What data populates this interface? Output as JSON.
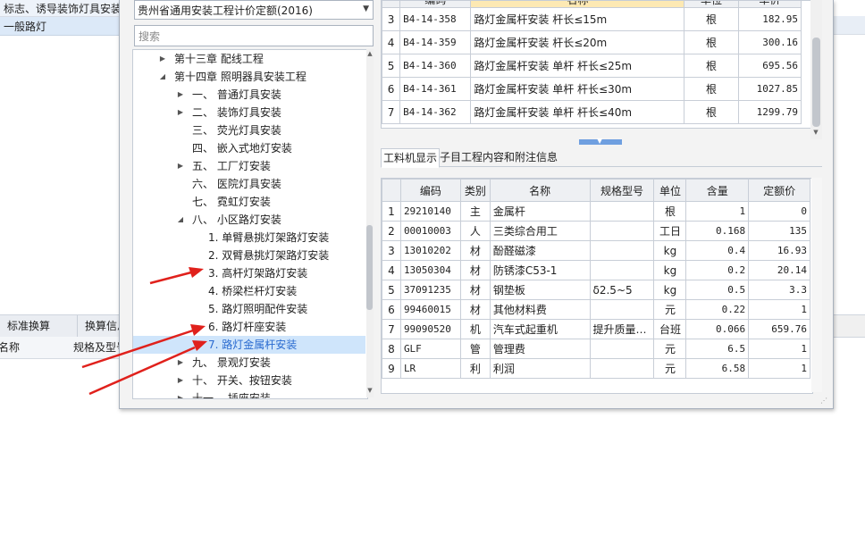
{
  "background": {
    "row1_text": "标志、诱导装饰灯具安装",
    "row2_text": "一般路灯",
    "tabs": [
      "标准换算",
      "换算信息"
    ],
    "columns": [
      "名称",
      "规格及型号"
    ]
  },
  "left_panel": {
    "quota_select": "贵州省通用安装工程计价定额(2016)",
    "search_placeholder": "搜索",
    "tree": [
      {
        "label": "第十三章  配线工程",
        "state": "collapsed"
      },
      {
        "label": "第十四章  照明器具安装工程",
        "state": "expanded"
      },
      {
        "label": "一、  普通灯具安装",
        "state": "collapsed"
      },
      {
        "label": "二、  装饰灯具安装",
        "state": "collapsed"
      },
      {
        "label": "三、  荧光灯具安装",
        "state": "leaf"
      },
      {
        "label": "四、  嵌入式地灯安装",
        "state": "leaf"
      },
      {
        "label": "五、  工厂灯安装",
        "state": "collapsed"
      },
      {
        "label": "六、  医院灯具安装",
        "state": "leaf"
      },
      {
        "label": "七、  霓虹灯安装",
        "state": "leaf"
      },
      {
        "label": "八、  小区路灯安装",
        "state": "expanded"
      },
      {
        "label": "1.  单臂悬挑灯架路灯安装",
        "state": "leaf"
      },
      {
        "label": "2.  双臂悬挑灯架路灯安装",
        "state": "leaf"
      },
      {
        "label": "3.  高杆灯架路灯安装",
        "state": "leaf"
      },
      {
        "label": "4.  桥梁栏杆灯安装",
        "state": "leaf"
      },
      {
        "label": "5.  路灯照明配件安装",
        "state": "leaf"
      },
      {
        "label": "6.  路灯杆座安装",
        "state": "leaf"
      },
      {
        "label": "7.  路灯金属杆安装",
        "state": "selected"
      },
      {
        "label": "九、  景观灯安装",
        "state": "collapsed"
      },
      {
        "label": "十、  开关、按钮安装",
        "state": "collapsed"
      },
      {
        "label": "十一、  插座安装",
        "state": "collapsed"
      }
    ]
  },
  "top_grid": {
    "headers": [
      "",
      "编码",
      "名称",
      "单位",
      "单价"
    ],
    "rows": [
      {
        "no": "3",
        "code": "B4-14-358",
        "name": "路灯金属杆安装  杆长≤15m",
        "unit": "根",
        "price": "182.95"
      },
      {
        "no": "4",
        "code": "B4-14-359",
        "name": "路灯金属杆安装  杆长≤20m",
        "unit": "根",
        "price": "300.16"
      },
      {
        "no": "5",
        "code": "B4-14-360",
        "name": "路灯金属杆安装  单杆  杆长≤25m",
        "unit": "根",
        "price": "695.56"
      },
      {
        "no": "6",
        "code": "B4-14-361",
        "name": "路灯金属杆安装  单杆  杆长≤30m",
        "unit": "根",
        "price": "1027.85"
      },
      {
        "no": "7",
        "code": "B4-14-362",
        "name": "路灯金属杆安装  单杆  杆长≤40m",
        "unit": "根",
        "price": "1299.79"
      }
    ]
  },
  "sub_tabs": [
    "工料机显示",
    "子目工程内容和附注信息"
  ],
  "sub_grid": {
    "headers": [
      "",
      "编码",
      "类别",
      "名称",
      "规格型号",
      "单位",
      "含量",
      "定额价"
    ],
    "rows": [
      {
        "no": "1",
        "code": "29210140",
        "type": "主",
        "name": "金属杆",
        "spec": "",
        "unit": "根",
        "qty": "1",
        "price": "0"
      },
      {
        "no": "2",
        "code": "00010003",
        "type": "人",
        "name": "三类综合用工",
        "spec": "",
        "unit": "工日",
        "qty": "0.168",
        "price": "135"
      },
      {
        "no": "3",
        "code": "13010202",
        "type": "材",
        "name": "酚醛磁漆",
        "spec": "",
        "unit": "kg",
        "qty": "0.4",
        "price": "16.93"
      },
      {
        "no": "4",
        "code": "13050304",
        "type": "材",
        "name": "防锈漆C53-1",
        "spec": "",
        "unit": "kg",
        "qty": "0.2",
        "price": "20.14"
      },
      {
        "no": "5",
        "code": "37091235",
        "type": "材",
        "name": "钢垫板",
        "spec": "δ2.5~5",
        "unit": "kg",
        "qty": "0.5",
        "price": "3.3"
      },
      {
        "no": "6",
        "code": "99460015",
        "type": "材",
        "name": "其他材料费",
        "spec": "",
        "unit": "元",
        "qty": "0.22",
        "price": "1"
      },
      {
        "no": "7",
        "code": "99090520",
        "type": "机",
        "name": "汽车式起重机",
        "spec": "提升质量…",
        "unit": "台班",
        "qty": "0.066",
        "price": "659.76"
      },
      {
        "no": "8",
        "code": "GLF",
        "type": "管",
        "name": "管理费",
        "spec": "",
        "unit": "元",
        "qty": "6.5",
        "price": "1"
      },
      {
        "no": "9",
        "code": "LR",
        "type": "利",
        "name": "利润",
        "spec": "",
        "unit": "元",
        "qty": "6.58",
        "price": "1"
      }
    ]
  },
  "colors": {
    "arrow": "#e0211c",
    "selection": "#cfe5fb",
    "selected_text": "#2a6bd0",
    "header_highlight": "#fde9b3",
    "splitter": "#6f9fe0"
  },
  "icons": {
    "dropdown": "chevron-down-icon",
    "expand": "triangle-right-icon",
    "collapse": "triangle-down-icon",
    "splitter": "triangle-down-icon"
  }
}
